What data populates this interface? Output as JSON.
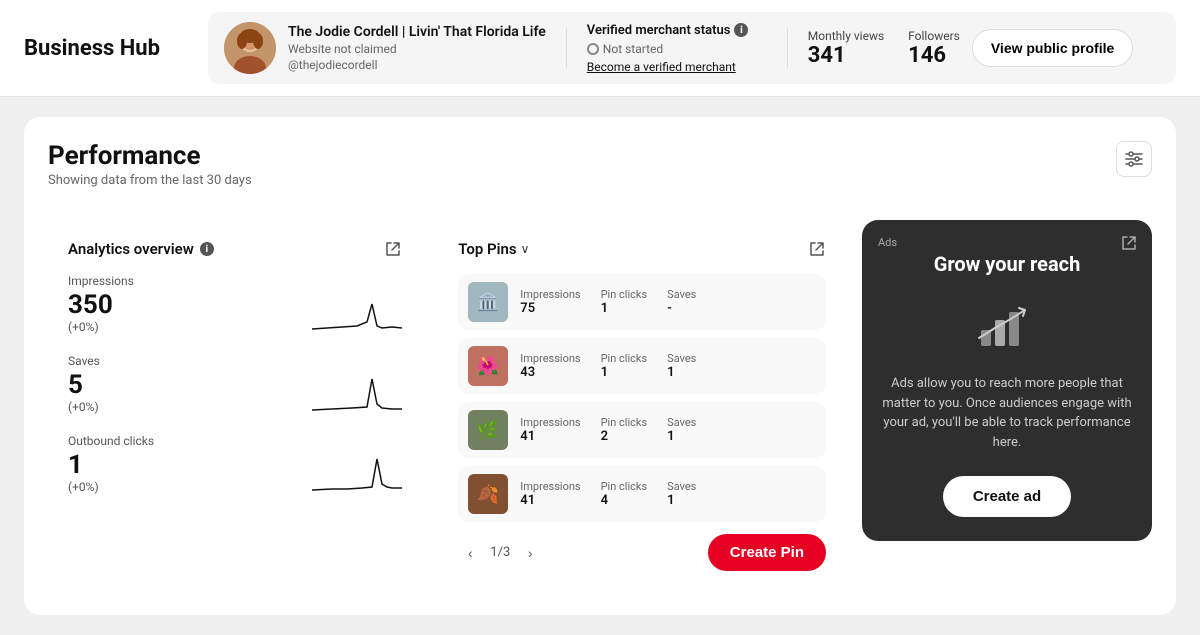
{
  "header": {
    "title": "Business Hub",
    "profile": {
      "name": "The Jodie Cordell | Livin' That Florida Life",
      "website": "Website not claimed",
      "handle": "@thejodiecordell",
      "avatar_emoji": "👩"
    },
    "verified": {
      "title": "Verified merchant status",
      "status": "Not started",
      "link_text": "Become a verified merchant"
    },
    "monthly_views": {
      "label": "Monthly views",
      "value": "341"
    },
    "followers": {
      "label": "Followers",
      "value": "146"
    },
    "view_profile_btn": "View public profile"
  },
  "performance": {
    "title": "Performance",
    "subtitle": "Showing data from the last 30 days",
    "analytics": {
      "title": "Analytics overview",
      "metrics": [
        {
          "label": "Impressions",
          "value": "350",
          "change": "(+0%)"
        },
        {
          "label": "Saves",
          "value": "5",
          "change": "(+0%)"
        },
        {
          "label": "Outbound clicks",
          "value": "1",
          "change": "(+0%)"
        }
      ]
    },
    "top_pins": {
      "title": "Top Pins",
      "pins": [
        {
          "impressions": "75",
          "pin_clicks": "1",
          "saves": "-",
          "emoji": "🏛️"
        },
        {
          "impressions": "43",
          "pin_clicks": "1",
          "saves": "1",
          "emoji": "🌺"
        },
        {
          "impressions": "41",
          "pin_clicks": "2",
          "saves": "1",
          "emoji": "🌿"
        },
        {
          "impressions": "41",
          "pin_clicks": "4",
          "saves": "1",
          "emoji": "🍂"
        }
      ],
      "pagination": "1/3",
      "create_pin_btn": "Create Pin"
    },
    "ads": {
      "badge": "Ads",
      "title": "Grow your reach",
      "body": "Ads allow you to reach more people that matter to you. Once audiences engage with your ad, you'll be able to track performance here.",
      "create_ad_btn": "Create ad"
    }
  },
  "icons": {
    "info": "i",
    "external_link": "↗",
    "filter": "⚙",
    "chevron_down": "∨",
    "arrow_left": "‹",
    "arrow_right": "›"
  }
}
